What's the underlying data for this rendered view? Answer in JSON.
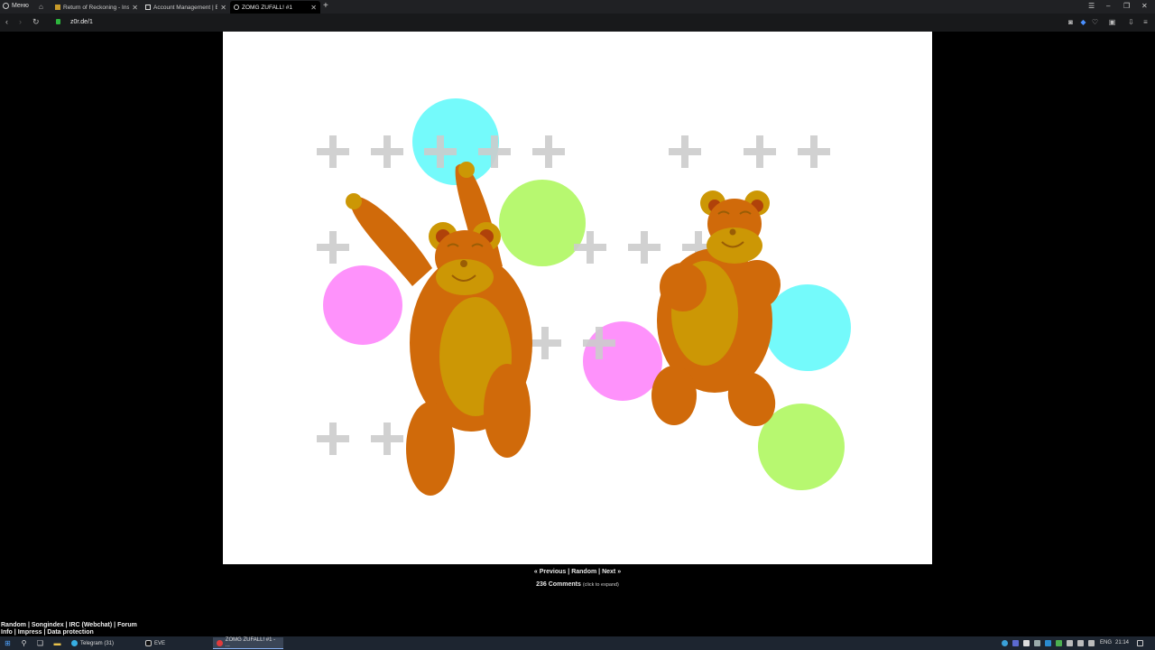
{
  "browser": {
    "menu_label": "Меню",
    "tabs": [
      {
        "title": "Return of Reckoning - Insi",
        "favicon_color": "#c89b2a"
      },
      {
        "title": "Account Management | EV",
        "favicon_color": "#dddddd"
      },
      {
        "title": "ZOMG ZUFALL! #1",
        "favicon_color": "#d0d0d0"
      }
    ],
    "new_tab": "+",
    "url": "z0r.de/1"
  },
  "page": {
    "colors": {
      "bear": "#d06a0a",
      "bear_belly": "#cc9705",
      "cyan": "#74fafb",
      "green": "#b7f870",
      "pink": "#fe92fb",
      "plus": "#cccccc"
    },
    "nav": {
      "previous": "« Previous",
      "random": "Random",
      "next": "Next »",
      "sep": "|"
    },
    "comments": {
      "label": "236 Comments",
      "hint": "(click to expand)"
    },
    "footer": {
      "line1": [
        "Random",
        "Songindex",
        "IRC (Webchat)",
        "Forum"
      ],
      "line2": [
        "Info",
        "Impress",
        "Data protection"
      ]
    }
  },
  "taskbar": {
    "apps": [
      {
        "label": "Telegram (31)",
        "color": "#37aee2"
      },
      {
        "label": "EVE",
        "color": "#cccccc"
      },
      {
        "label": "ZOMG ZUFALL! #1 - ...",
        "color": "#e23b3b"
      }
    ],
    "lang": "ENG",
    "time": "21:14"
  }
}
